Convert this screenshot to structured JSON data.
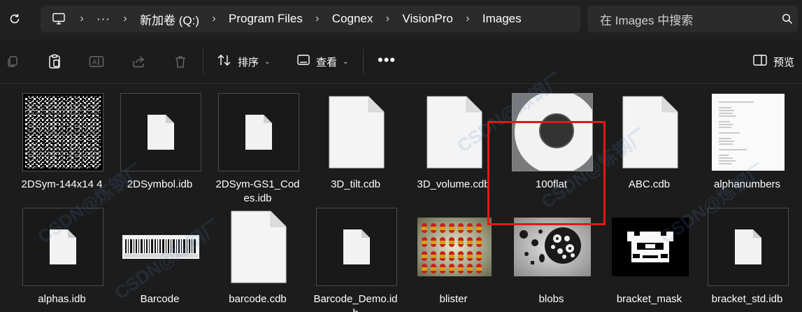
{
  "address_bar": {
    "crumbs": [
      "新加卷 (Q:)",
      "Program Files",
      "Cognex",
      "VisionPro",
      "Images"
    ],
    "overflow": "···",
    "search_placeholder": "在 Images 中搜索"
  },
  "toolbar": {
    "sort_label": "排序",
    "view_label": "查看",
    "more": "•••",
    "preview_label": "预览"
  },
  "files": [
    {
      "name": "2DSym-144x14 4",
      "kind": "datamatrix"
    },
    {
      "name": "2DSymbol.idb",
      "kind": "doc-small"
    },
    {
      "name": "2DSym-GS1_Codes.idb",
      "kind": "doc-small"
    },
    {
      "name": "3D_tilt.cdb",
      "kind": "doc-large"
    },
    {
      "name": "3D_volume.cdb",
      "kind": "doc-large"
    },
    {
      "name": "100flat",
      "kind": "flat-disc"
    },
    {
      "name": "ABC.cdb",
      "kind": "doc-large"
    },
    {
      "name": "alphanumbers",
      "kind": "text-page"
    },
    {
      "name": "alphas.idb",
      "kind": "doc-small"
    },
    {
      "name": "Barcode",
      "kind": "barcode"
    },
    {
      "name": "barcode.cdb",
      "kind": "doc-large"
    },
    {
      "name": "Barcode_Demo.idb",
      "kind": "doc-small"
    },
    {
      "name": "blister",
      "kind": "blister"
    },
    {
      "name": "blobs",
      "kind": "blobs"
    },
    {
      "name": "bracket_mask",
      "kind": "bracket"
    },
    {
      "name": "bracket_std.idb",
      "kind": "doc-small"
    }
  ],
  "watermark": "CSDN@炼钢厂"
}
